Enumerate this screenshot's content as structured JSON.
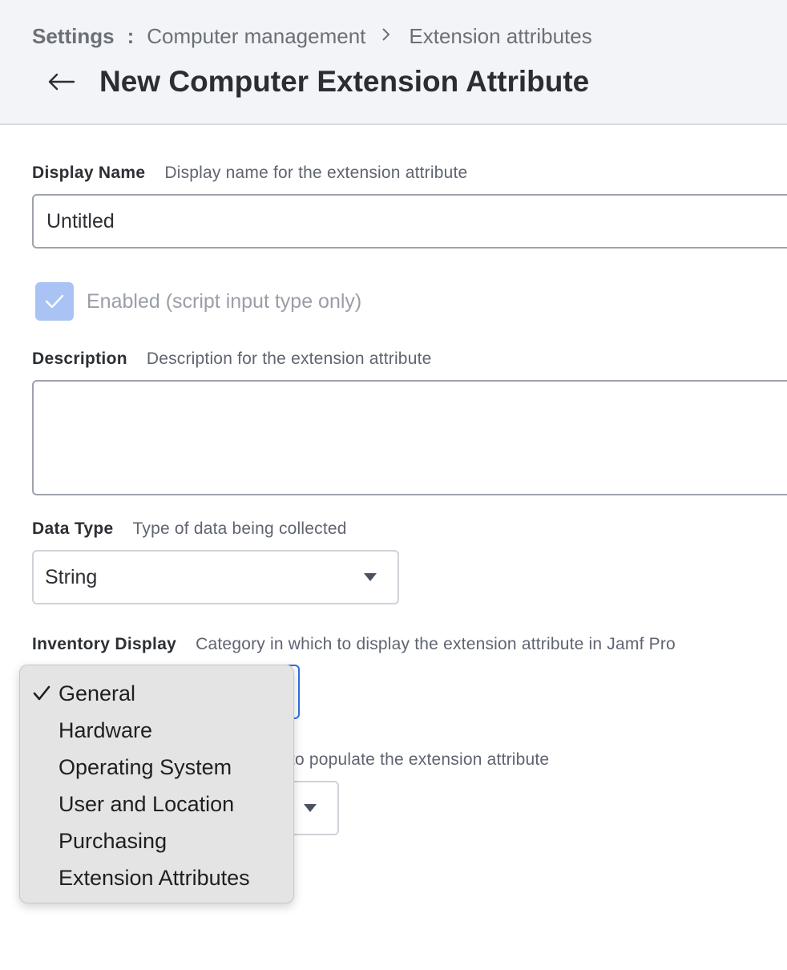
{
  "header": {
    "breadcrumb": {
      "root": "Settings",
      "separator_colon": ":",
      "items": [
        "Computer management",
        "Extension attributes"
      ]
    },
    "title": "New Computer Extension Attribute"
  },
  "form": {
    "display_name": {
      "label": "Display Name",
      "help": "Display name for the extension attribute",
      "value": "Untitled"
    },
    "enabled": {
      "label": "Enabled (script input type only)",
      "checked": true
    },
    "description": {
      "label": "Description",
      "help": "Description for the extension attribute",
      "value": ""
    },
    "data_type": {
      "label": "Data Type",
      "help": "Type of data being collected",
      "value": "String"
    },
    "inventory_display": {
      "label": "Inventory Display",
      "help": "Category in which to display the extension attribute in Jamf Pro",
      "selected": "General",
      "options": [
        "General",
        "Hardware",
        "Operating System",
        "User and Location",
        "Purchasing",
        "Extension Attributes"
      ]
    },
    "input_type": {
      "help_partial": "e to populate the extension attribute"
    }
  },
  "colors": {
    "header_bg": "#f3f4f7",
    "checkbox_fill": "#a9c3f4",
    "focus_border": "#2f6fe0",
    "dropdown_bg": "#e4e4e4"
  },
  "icons": {
    "back": "arrow-left-icon",
    "breadcrumb_separator": "chevron-right-icon",
    "checkbox": "checkmark-icon",
    "select_caret": "caret-down-icon",
    "selected_option": "checkmark-icon"
  }
}
